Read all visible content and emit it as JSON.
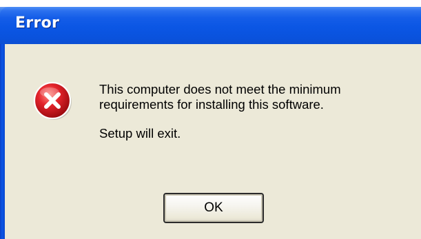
{
  "window": {
    "title": "Error"
  },
  "dialog": {
    "icon": "error-x-icon",
    "message_line1": "This computer does not meet the minimum",
    "message_line2": "requirements for installing this software.",
    "exit_message": "Setup will exit.",
    "ok_label": "OK"
  },
  "colors": {
    "titlebar": "#0a56e6",
    "client_background": "#ece9d8",
    "error_icon": "#d4121b"
  }
}
